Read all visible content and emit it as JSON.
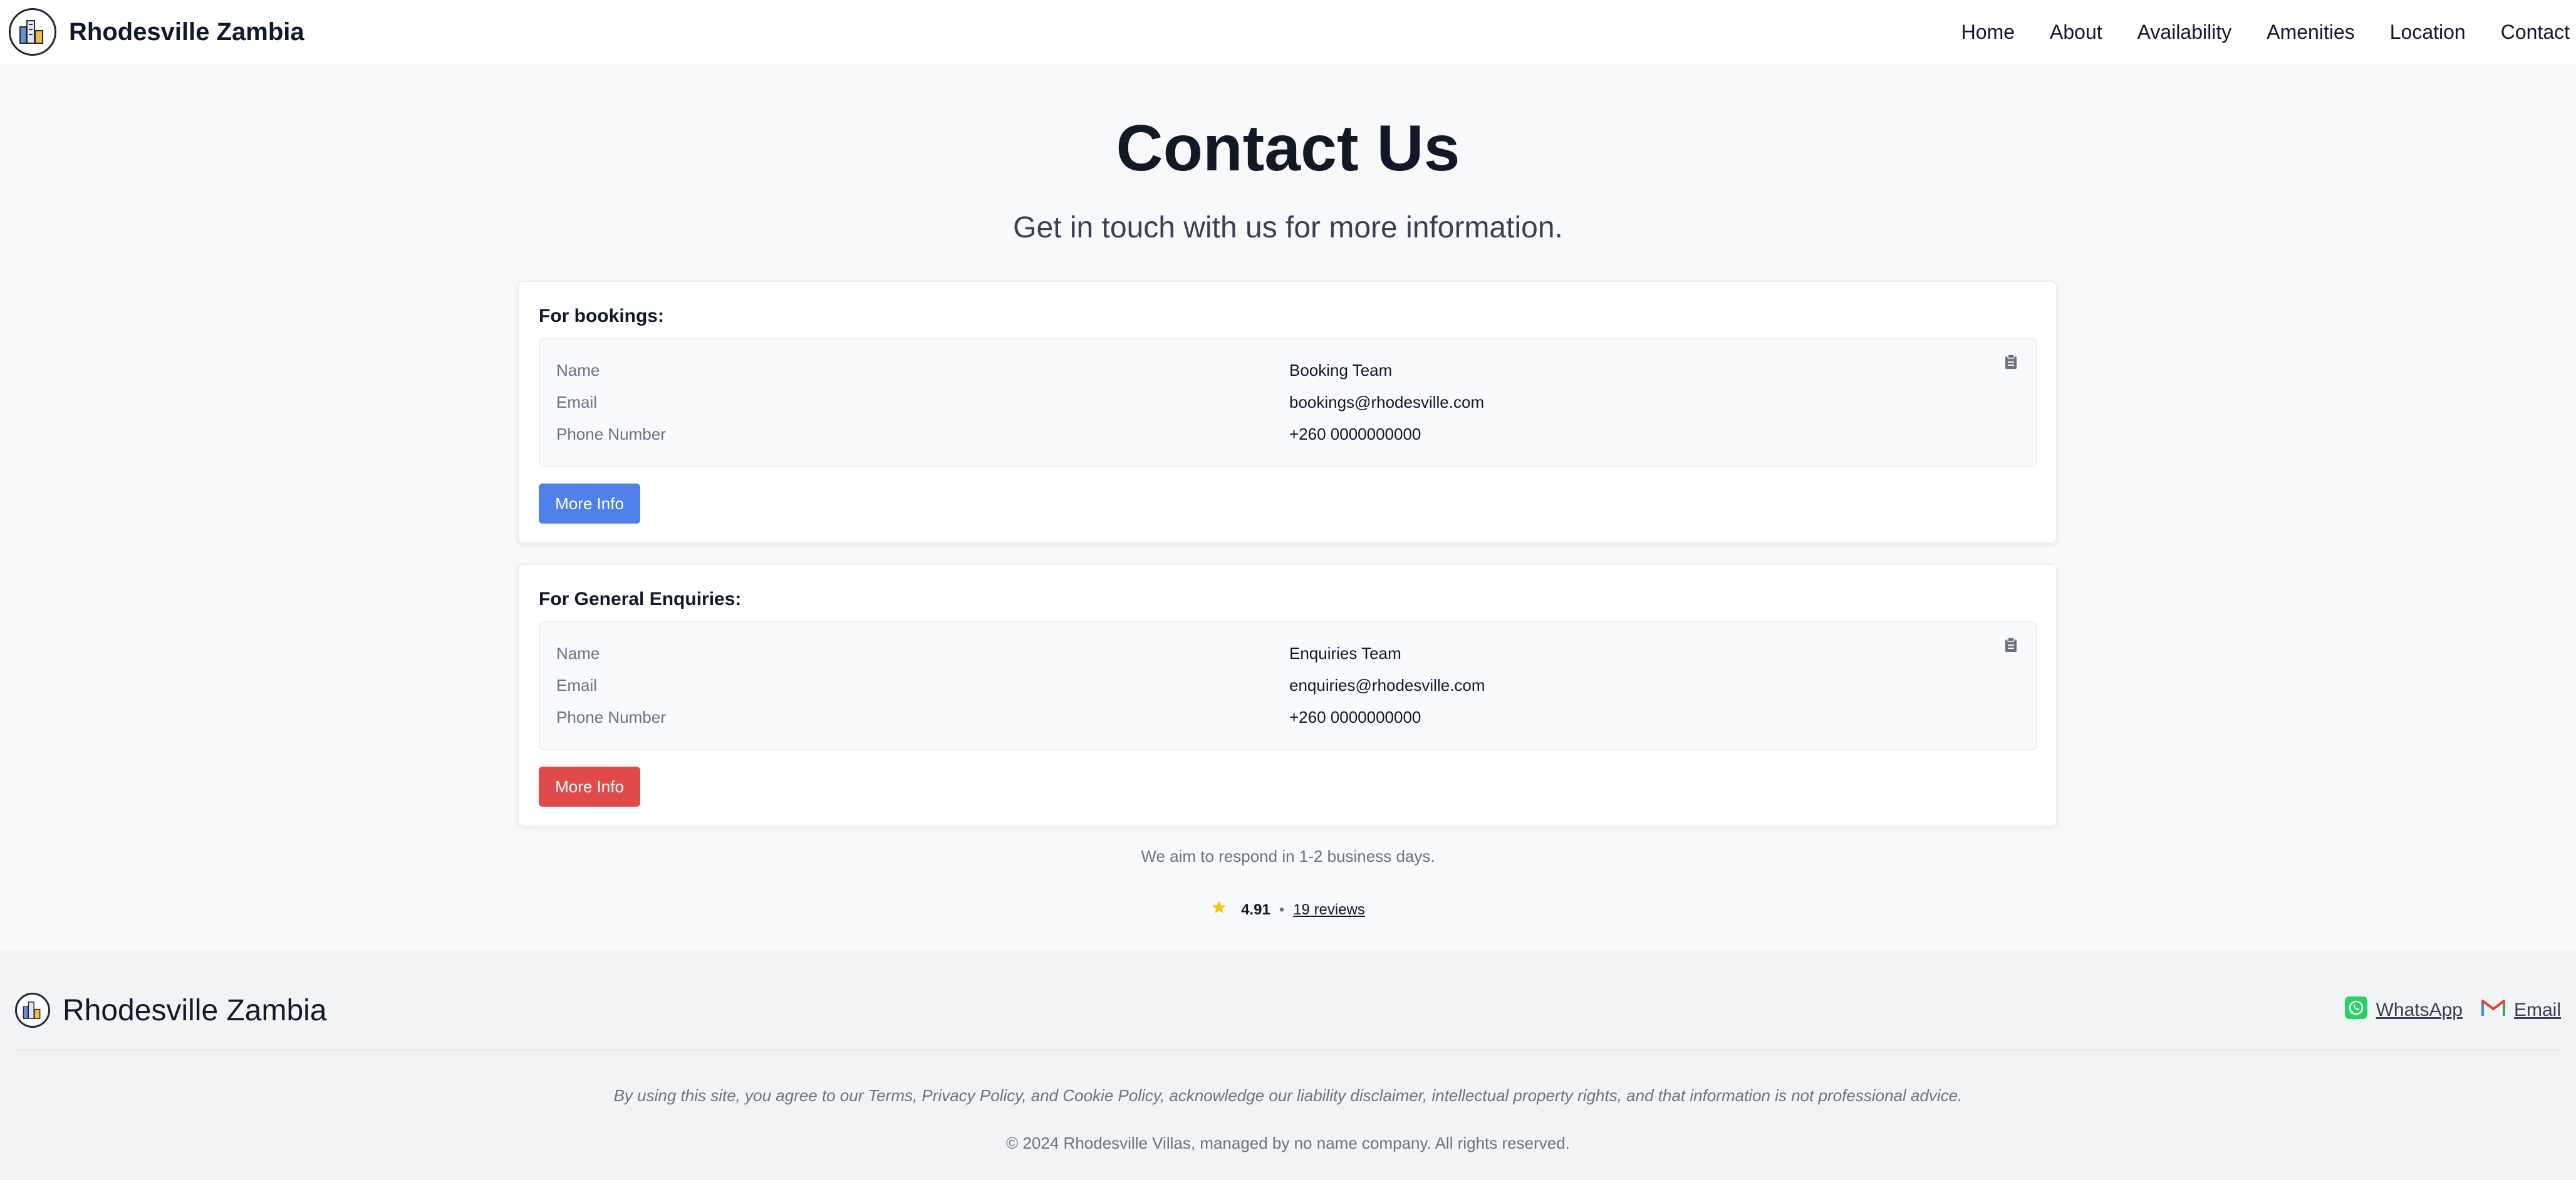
{
  "header": {
    "brand_name": "Rhodesville Zambia",
    "nav": [
      "Home",
      "About",
      "Availability",
      "Amenities",
      "Location",
      "Contact"
    ]
  },
  "hero": {
    "title": "Contact Us",
    "subtitle": "Get in touch with us for more information."
  },
  "contacts": [
    {
      "heading": "For bookings:",
      "rows": [
        {
          "label": "Name",
          "value": "Booking Team"
        },
        {
          "label": "Email",
          "value": "bookings@rhodesville.com"
        },
        {
          "label": "Phone Number",
          "value": "+260 0000000000"
        }
      ],
      "button_label": "More Info",
      "button_color": "#4f80ea"
    },
    {
      "heading": "For General Enquiries:",
      "rows": [
        {
          "label": "Name",
          "value": "Enquiries Team"
        },
        {
          "label": "Email",
          "value": "enquiries@rhodesville.com"
        },
        {
          "label": "Phone Number",
          "value": "+260 0000000000"
        }
      ],
      "button_label": "More Info",
      "button_color": "#e14a4a"
    }
  ],
  "response_note": "We aim to respond in 1-2 business days.",
  "rating": {
    "score": "4.91",
    "separator": "•",
    "reviews": "19 reviews",
    "star_color": "#f5c518"
  },
  "footer": {
    "brand_name": "Rhodesville Zambia",
    "links": [
      {
        "label": "WhatsApp",
        "icon": "whatsapp-icon",
        "color": "#25d366"
      },
      {
        "label": "Email",
        "icon": "gmail-icon",
        "color": "#ea4335"
      }
    ],
    "disclaimer": "By using this site, you agree to our Terms, Privacy Policy, and Cookie Policy, acknowledge our liability disclaimer, intellectual property rights, and that information is not professional advice.",
    "copyright": "© 2024 Rhodesville Villas, managed by no name company. All rights reserved."
  }
}
